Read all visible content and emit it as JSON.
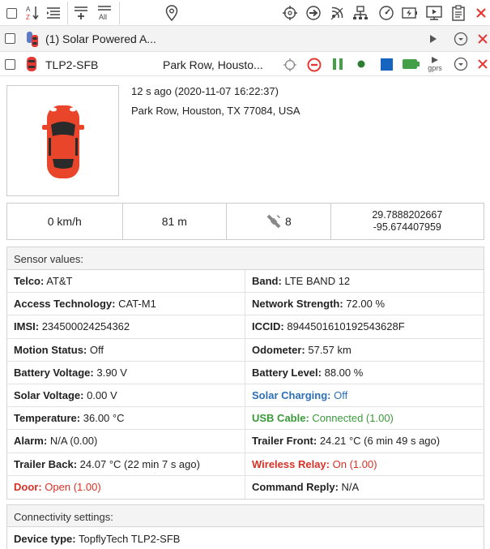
{
  "toolbar": {
    "icons": [
      "checkbox-all",
      "sort-az-icon",
      "collapse-list-icon",
      "expand-add-icon",
      "expand-all-icon",
      "map-pin-icon",
      "crosshair-icon",
      "arrow-right-circle-icon",
      "signal-icon",
      "network-icon",
      "gauge-icon",
      "battery-charge-icon",
      "monitor-play-icon",
      "clipboard-icon",
      "close-icon"
    ],
    "sort_sub": "A Z",
    "expand_all_label": "All"
  },
  "group": {
    "label": "(1) Solar Powered A..."
  },
  "device": {
    "name": "TLP2-SFB",
    "address_short": "Park Row, Housto...",
    "gprs_label": "gprs",
    "colors": {
      "stop": "#e53935",
      "pause": "#43a047",
      "dot": "#2e7d32",
      "square": "#1565c0",
      "battery": "#43a047"
    }
  },
  "info": {
    "time": "12 s ago (2020-11-07 16:22:37)",
    "address": "Park Row, Houston, TX 77084, USA",
    "speed": "0 km/h",
    "altitude": "81 m",
    "satellites": "8",
    "lat": "29.7888202667",
    "lon": "-95.674407959"
  },
  "sensors": {
    "title": "Sensor values:",
    "rows": [
      [
        {
          "label": "Telco:",
          "value": "AT&T",
          "style": ""
        },
        {
          "label": "Band:",
          "value": "LTE BAND 12",
          "style": ""
        }
      ],
      [
        {
          "label": "Access Technology:",
          "value": "CAT-M1",
          "style": ""
        },
        {
          "label": "Network Strength:",
          "value": "72.00 %",
          "style": ""
        }
      ],
      [
        {
          "label": "IMSI:",
          "value": "234500024254362",
          "style": ""
        },
        {
          "label": "ICCID:",
          "value": "8944501610192543628F",
          "style": ""
        }
      ],
      [
        {
          "label": "Motion Status:",
          "value": "Off",
          "style": ""
        },
        {
          "label": "Odometer:",
          "value": "57.57 km",
          "style": ""
        }
      ],
      [
        {
          "label": "Battery Voltage:",
          "value": "3.90 V",
          "style": ""
        },
        {
          "label": "Battery Level:",
          "value": "88.00 %",
          "style": ""
        }
      ],
      [
        {
          "label": "Solar Voltage:",
          "value": "0.00 V",
          "style": ""
        },
        {
          "label": "Solar Charging:",
          "value": "Off",
          "style": "blue"
        }
      ],
      [
        {
          "label": "Temperature:",
          "value": "36.00 °C",
          "style": ""
        },
        {
          "label": "USB Cable:",
          "value": "Connected (1.00)",
          "style": "green"
        }
      ],
      [
        {
          "label": "Alarm:",
          "value": "N/A (0.00)",
          "style": ""
        },
        {
          "label": "Trailer Front:",
          "value": "24.21 °C (6 min 49 s ago)",
          "style": ""
        }
      ],
      [
        {
          "label": "Trailer Back:",
          "value": "24.07 °C (22 min 7 s ago)",
          "style": ""
        },
        {
          "label": "Wireless Relay:",
          "value": "On (1.00)",
          "style": "red"
        }
      ],
      [
        {
          "label": "Door:",
          "value": "Open (1.00)",
          "style": "red"
        },
        {
          "label": "Command Reply:",
          "value": "N/A",
          "style": ""
        }
      ]
    ]
  },
  "connectivity": {
    "title": "Connectivity settings:",
    "device_type_label": "Device type:",
    "device_type_value": "TopflyTech TLP2-SFB"
  }
}
